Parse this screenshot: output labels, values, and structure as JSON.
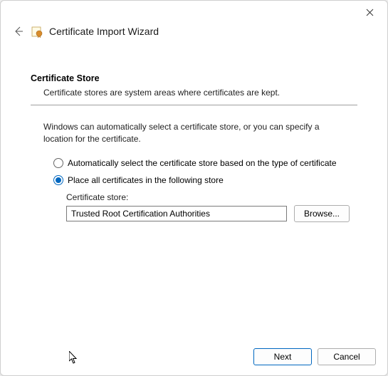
{
  "window": {
    "title": "Certificate Import Wizard"
  },
  "section": {
    "heading": "Certificate Store",
    "subtext": "Certificate stores are system areas where certificates are kept."
  },
  "intro": "Windows can automatically select a certificate store, or you can specify a location for the certificate.",
  "options": {
    "auto": "Automatically select the certificate store based on the type of certificate",
    "place": "Place all certificates in the following store"
  },
  "store": {
    "label": "Certificate store:",
    "value": "Trusted Root Certification Authorities",
    "browse": "Browse..."
  },
  "buttons": {
    "next": "Next",
    "cancel": "Cancel"
  }
}
